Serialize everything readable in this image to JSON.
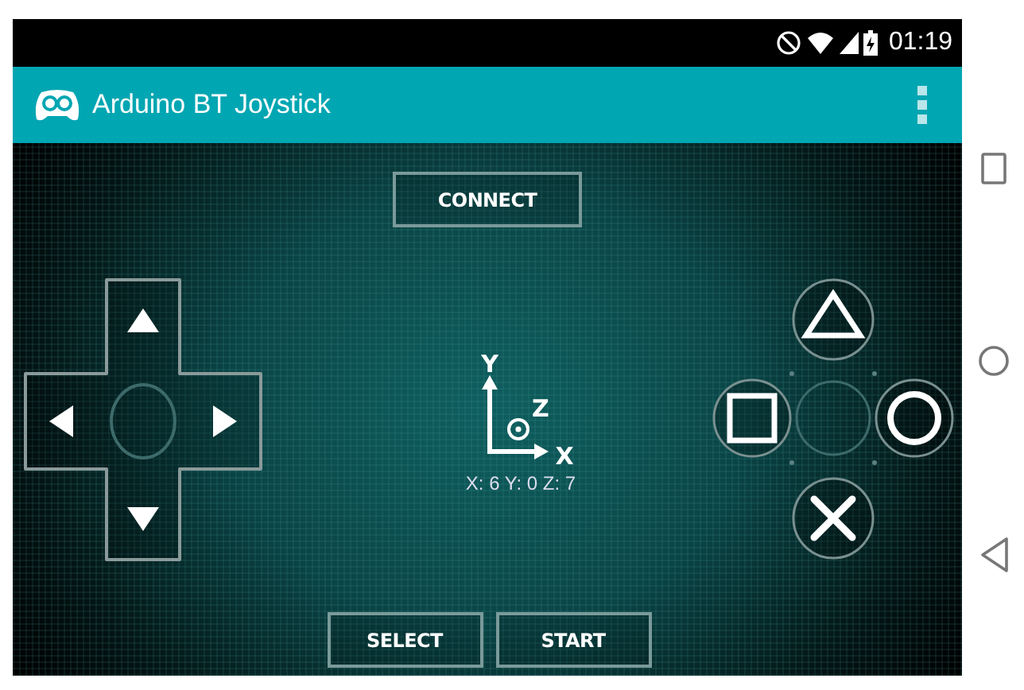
{
  "status_bar": {
    "time": "01:19"
  },
  "app_bar": {
    "title": "Arduino BT Joystick"
  },
  "connect_button": "CONNECT",
  "axes": {
    "labels": [
      "Y",
      "Z",
      "X"
    ],
    "reading": "X: 6 Y: 0 Z: 7"
  },
  "bottom_buttons": [
    "SELECT",
    "START"
  ]
}
